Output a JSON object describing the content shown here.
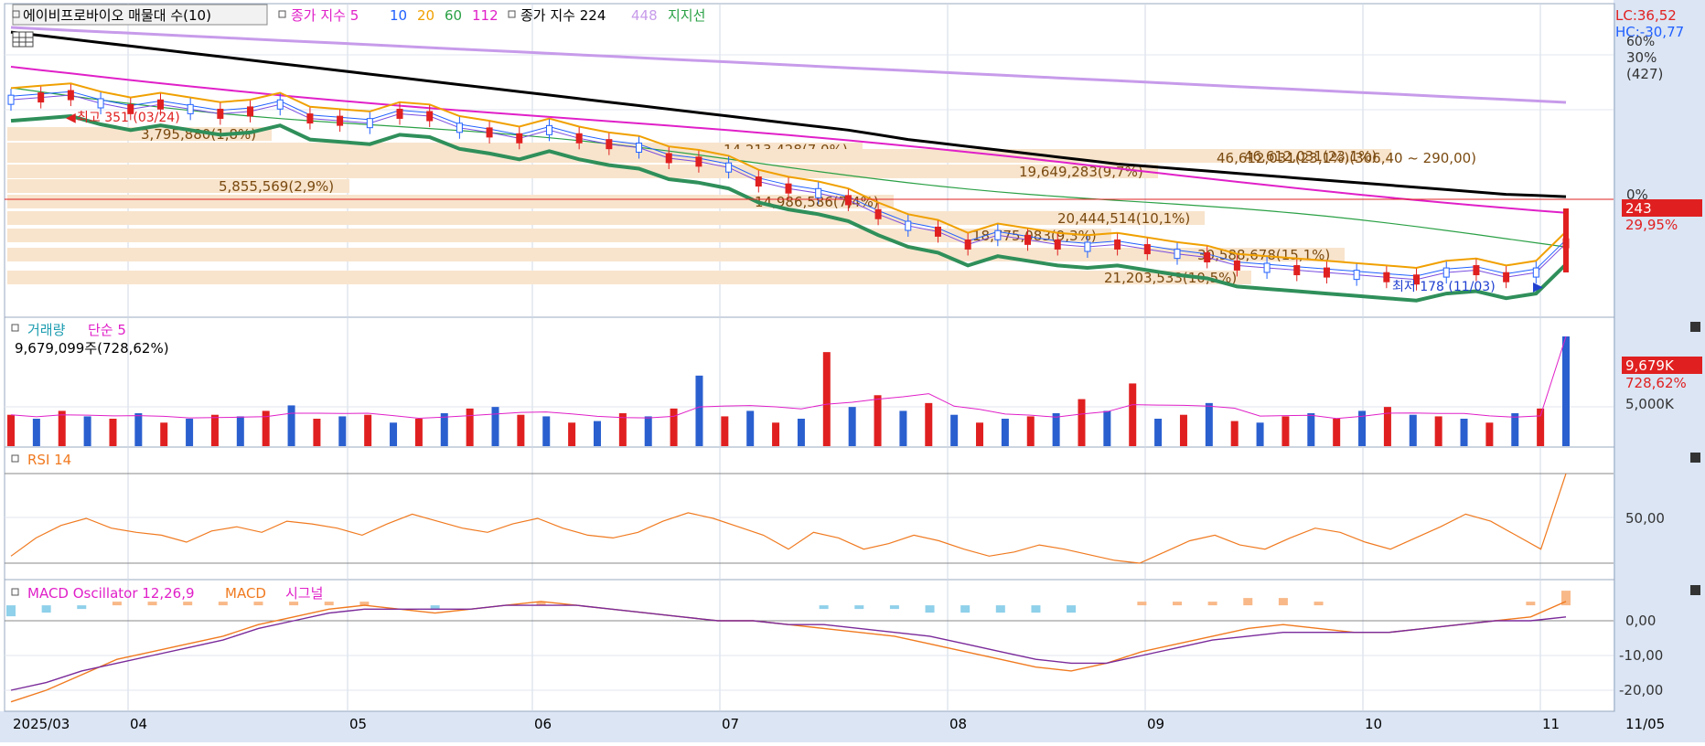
{
  "legend": {
    "stock_name": "에이비프로바이오 매물대 수(10)",
    "ma_label": "종가 지수 5",
    "ma_10": "10",
    "ma_20": "20",
    "ma_60": "60",
    "ma_112": "112",
    "ma2_label": "종가 지수 224",
    "ma_448": "448",
    "support_label": "지지선"
  },
  "price_axis": {
    "lc": "LC:36,52",
    "hc": "HC:-30,77",
    "pct_60": "60%",
    "pct_30": "30%",
    "count": "(427)",
    "pct_0": "0%",
    "last_price": "243",
    "last_change": "29,95%"
  },
  "annotations": {
    "high": "최고 351 (03/24)",
    "low": "최저 178 (11/03)",
    "range_note": "46,612,031(23,1%)(306,40 ~ 290,00)"
  },
  "volume_profile": [
    {
      "label": "3,795,880(1,8%)",
      "frac": 0.17
    },
    {
      "label": "14,213,428(7,0%)",
      "frac": 0.55
    },
    {
      "label": "46,612,031(23,1%)",
      "frac": 0.89
    },
    {
      "label": "19,649,283(9,7%)",
      "frac": 0.74
    },
    {
      "label": "5,855,569(2,9%)",
      "frac": 0.22
    },
    {
      "label": "14,986,586(7,4%)",
      "frac": 0.57
    },
    {
      "label": "20,444,514(10,1%)",
      "frac": 0.77
    },
    {
      "label": "18,775,083(9,3%)",
      "frac": 0.71
    },
    {
      "label": "30,588,678(15,1%)",
      "frac": 0.86
    },
    {
      "label": "21,203,533(10,5%)",
      "frac": 0.8
    }
  ],
  "volume_panel": {
    "title": "거래량",
    "ma_label": "단순 5",
    "current": "9,679,099주(728,62%)",
    "axis_5000k": "5,000K",
    "badge_value": "9,679K",
    "badge_pct": "728,62%"
  },
  "rsi_panel": {
    "title": "RSI 14",
    "axis_50": "50,00"
  },
  "macd_panel": {
    "title_osc": "MACD Oscillator 12,26,9",
    "title_macd": "MACD",
    "title_signal": "시그널",
    "axis_0": "0,00",
    "axis_m10": "-10,00",
    "axis_m20": "-20,00"
  },
  "time_axis": {
    "labels": [
      "2025/03",
      "04",
      "05",
      "06",
      "07",
      "08",
      "09",
      "10",
      "11"
    ],
    "right_label": "11/05"
  },
  "chart_data": {
    "type": "candlestick",
    "price": {
      "last": 243,
      "high": 351,
      "low": 178,
      "range": [
        165,
        400
      ],
      "ma_5": [
        338,
        340,
        342,
        335,
        330,
        334,
        330,
        326,
        328,
        334,
        322,
        320,
        318,
        326,
        324,
        314,
        310,
        305,
        312,
        305,
        300,
        297,
        288,
        285,
        280,
        268,
        262,
        258,
        252,
        240,
        230,
        225,
        214,
        222,
        218,
        214,
        212,
        214,
        210,
        206,
        203,
        196,
        194,
        192,
        190,
        188,
        186,
        184,
        190,
        192,
        186,
        190,
        215
      ],
      "ma_224": [
        396,
        393,
        390,
        387,
        384,
        381,
        378,
        375,
        372,
        369,
        366,
        363,
        360,
        357,
        354,
        351,
        348,
        345,
        342,
        339,
        336,
        333,
        330,
        327,
        324,
        321,
        318,
        315,
        312,
        308,
        304,
        301,
        298,
        295,
        292,
        289,
        286,
        283,
        281,
        279,
        277,
        275,
        273,
        271,
        269,
        267,
        265,
        263,
        261,
        259,
        257,
        256,
        255
      ]
    },
    "volume": {
      "current": 9679099,
      "bars_k": [
        400,
        350,
        450,
        380,
        350,
        420,
        300,
        350,
        400,
        380,
        450,
        520,
        350,
        380,
        400,
        300,
        350,
        420,
        480,
        500,
        400,
        380,
        300,
        320,
        420,
        380,
        480,
        900,
        380,
        450,
        300,
        350,
        1200,
        500,
        650,
        450,
        550,
        400,
        300,
        350,
        380,
        420,
        600,
        450,
        800,
        350,
        400,
        550,
        320,
        300,
        380,
        420,
        350,
        450,
        500,
        400,
        380,
        350,
        300,
        420,
        480,
        9679
      ]
    },
    "rsi": {
      "values": [
        25,
        38,
        47,
        52,
        45,
        42,
        40,
        35,
        43,
        46,
        42,
        50,
        48,
        45,
        40,
        48,
        55,
        50,
        45,
        42,
        48,
        52,
        45,
        40,
        38,
        42,
        50,
        56,
        52,
        46,
        40,
        30,
        42,
        38,
        30,
        34,
        40,
        36,
        30,
        25,
        28,
        33,
        30,
        26,
        22,
        20,
        28,
        36,
        40,
        33,
        30,
        38,
        45,
        42,
        35,
        30,
        38,
        46,
        55,
        50,
        40,
        30,
        84
      ]
    },
    "macd": {
      "macd": [
        -25,
        -22,
        -18,
        -14,
        -12,
        -10,
        -8,
        -5,
        -3,
        -1,
        0,
        -1,
        -2,
        -1,
        0,
        1,
        0,
        -1,
        -2,
        -3,
        -4,
        -4,
        -5,
        -6,
        -7,
        -8,
        -10,
        -12,
        -14,
        -16,
        -17,
        -15,
        -12,
        -10,
        -8,
        -6,
        -5,
        -6,
        -7,
        -7,
        -6,
        -5,
        -4,
        -3,
        1
      ],
      "signal": [
        -22,
        -20,
        -17,
        -15,
        -13,
        -11,
        -9,
        -6,
        -4,
        -2,
        -1,
        -1,
        -1,
        -1,
        0,
        0,
        0,
        -1,
        -2,
        -3,
        -4,
        -4,
        -5,
        -5,
        -6,
        -7,
        -8,
        -10,
        -12,
        -14,
        -15,
        -15,
        -13,
        -11,
        -9,
        -8,
        -7,
        -7,
        -7,
        -7,
        -6,
        -5,
        -4,
        -4,
        -3
      ],
      "ylim": [
        -22,
        5
      ]
    }
  }
}
